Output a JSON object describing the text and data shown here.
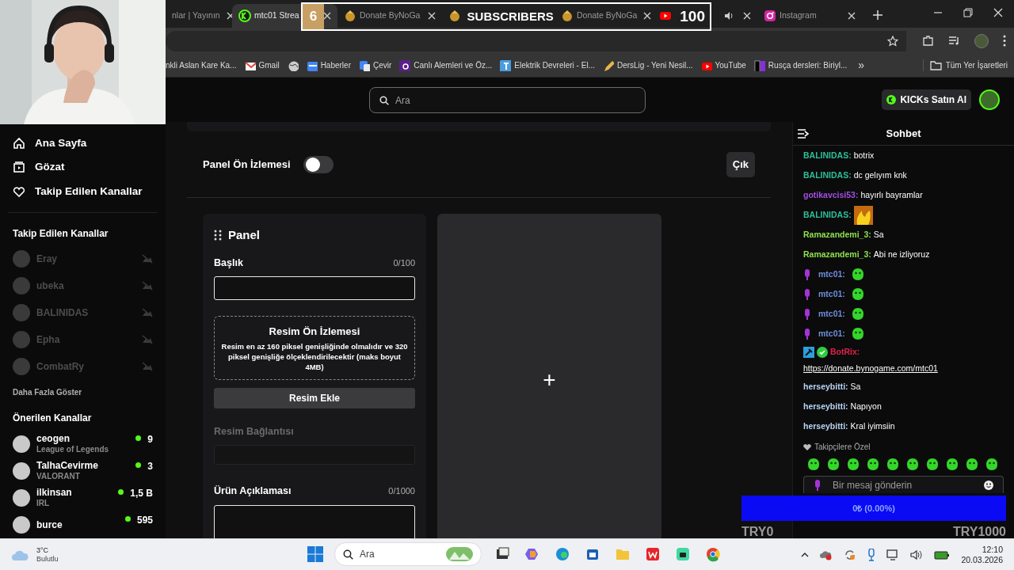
{
  "overlay_subscribers": {
    "count": "6",
    "label": "SUBSCRIBERS",
    "goal": "100"
  },
  "browser": {
    "tabs": [
      {
        "kind": "page",
        "title": "nlar | Yayının",
        "selected": false
      },
      {
        "kind": "kick",
        "title": "mtc01 Strea",
        "selected": true
      },
      {
        "kind": "donate",
        "title": "Donate ByNoGa",
        "selected": false
      },
      {
        "kind": "donate",
        "selected": false
      },
      {
        "kind": "donate",
        "title": "Donate ByNoGa",
        "selected": false
      },
      {
        "kind": "youtube",
        "audio": true,
        "selected": false
      },
      {
        "kind": "instagram",
        "title": "Instagram",
        "selected": false
      }
    ],
    "bookmarks": [
      {
        "kind": "plain",
        "title": "nkli Aslan Kare Ka..."
      },
      {
        "kind": "gmail",
        "title": "Gmail"
      },
      {
        "kind": "globe"
      },
      {
        "kind": "news",
        "title": "Haberler"
      },
      {
        "kind": "translate",
        "title": "Çevir"
      },
      {
        "kind": "bp",
        "title": "Canlı Alemleri ve Öz..."
      },
      {
        "kind": "electric",
        "title": "Elektrik Devreleri - El..."
      },
      {
        "kind": "pencil",
        "title": "DersLig - Yeni Nesil..."
      },
      {
        "kind": "youtube",
        "title": "YouTube"
      },
      {
        "kind": "lr",
        "title": "Rusça dersleri: Biriyl..."
      }
    ],
    "more": "»",
    "all_bookmarks": "Tüm Yer İşaretleri"
  },
  "topbar": {
    "search": {
      "placeholder": "Ara"
    },
    "kicks_button": "KICKs Satın Al"
  },
  "sidebar": {
    "nav": [
      {
        "kind": "home",
        "label": "Ana Sayfa"
      },
      {
        "kind": "browse",
        "label": "Gözat"
      },
      {
        "kind": "heart",
        "label": "Takip Edilen Kanallar"
      }
    ],
    "followed_heading": "Takip Edilen Kanallar",
    "followed": [
      {
        "name": "Eray",
        "live": false
      },
      {
        "name": "ubeka",
        "live": false
      },
      {
        "name": "BALINIDAS",
        "live": false
      },
      {
        "name": "Epha",
        "live": false
      },
      {
        "name": "CombatRy",
        "live": false
      }
    ],
    "show_more": "Daha Fazla Göster",
    "recommended_heading": "Önerilen Kanallar",
    "recommended": [
      {
        "name": "ceogen",
        "category": "League of Legends",
        "viewers": "9",
        "live": true
      },
      {
        "name": "TalhaCevirme",
        "category": "VALORANT",
        "viewers": "3",
        "live": true
      },
      {
        "name": "ilkinsan",
        "category": "IRL",
        "viewers": "1,5 B",
        "live": true
      },
      {
        "name": "burce",
        "viewers": "595",
        "live": true
      }
    ]
  },
  "editor": {
    "preview_label": "Panel Ön İzlemesi",
    "preview_on": false,
    "exit_button": "Çık",
    "panel": {
      "title": "Panel",
      "title_field": {
        "label": "Başlık",
        "counter": "0/100"
      },
      "image_preview": {
        "title": "Resim Ön İzlemesi",
        "text": "Resim en az 160 piksel genişliğinde olmalıdır ve 320 piksel genişliğe ölçeklendirilecektir (maks boyut 4MB)"
      },
      "add_image_button": "Resim Ekle",
      "link_field": {
        "label": "Resim Bağlantısı",
        "disabled": true
      },
      "description_field": {
        "label": "Ürün Açıklaması",
        "counter": "0/1000"
      }
    },
    "add_panel": "+"
  },
  "chat": {
    "title": "Sohbet",
    "messages": [
      {
        "kind": "text",
        "user": "BALINIDAS:",
        "color": "#2dbf98",
        "text": "botrix"
      },
      {
        "kind": "text",
        "user": "BALINIDAS:",
        "color": "#2dbf98",
        "text": "dc gelıyım knk"
      },
      {
        "kind": "text",
        "user": "gotikavcisi53:",
        "color": "#a24fe0",
        "text": "hayırlı bayramlar"
      },
      {
        "kind": "fire_emote",
        "user": "BALINIDAS:",
        "color": "#2dbf98"
      },
      {
        "kind": "text",
        "user": "Ramazandemi_3:",
        "color": "#8fe04e",
        "text": "Sa"
      },
      {
        "kind": "text",
        "user": "Ramazandemi_3:",
        "color": "#8fe04e",
        "text": "Abi ne izliyoruz"
      },
      {
        "kind": "broadcaster_emote",
        "user": "mtc01:",
        "color": "#6f8fdc"
      },
      {
        "kind": "broadcaster_emote",
        "user": "mtc01:",
        "color": "#6f8fdc"
      },
      {
        "kind": "broadcaster_emote",
        "user": "mtc01:",
        "color": "#6f8fdc"
      },
      {
        "kind": "broadcaster_emote",
        "user": "mtc01:",
        "color": "#6f8fdc"
      },
      {
        "kind": "bot_link",
        "user": "BotRix:",
        "color": "#e0214b",
        "text": "https://donate.bynogame.com/mtc01"
      },
      {
        "kind": "text",
        "user": "herseybitti:",
        "color": "#b9d3f2",
        "text": "Sa"
      },
      {
        "kind": "text",
        "user": "herseybitti:",
        "color": "#b9d3f2",
        "text": "Napıyon"
      },
      {
        "kind": "text",
        "user": "herseybitti:",
        "color": "#b9d3f2",
        "text": "Kral iyimsiin"
      }
    ],
    "emote_section": "Takipçilere Özel",
    "input": {
      "placeholder": "Bir mesaj gönderin"
    }
  },
  "overlay_donation": {
    "level": 0,
    "reading": "0₺ (0.00%)",
    "min": "TRY0",
    "max": "TRY1000"
  },
  "taskbar": {
    "weather": {
      "temperature": "3°C",
      "condition": "Bulutlu"
    },
    "search": {
      "placeholder": "Ara"
    },
    "time": "12:10",
    "date": "20.03.2026"
  }
}
